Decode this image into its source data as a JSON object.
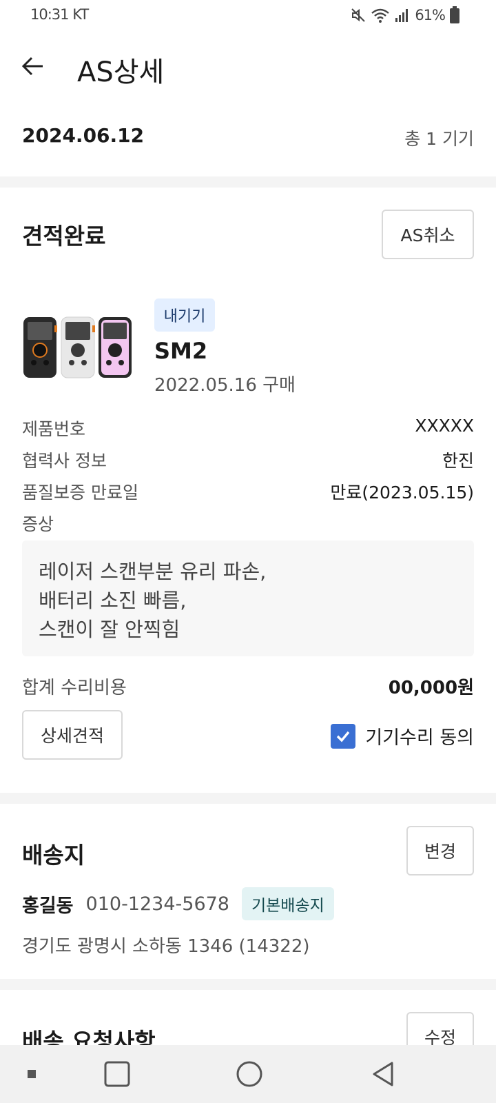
{
  "status_bar": {
    "time": "10:31 KT",
    "battery": "61%",
    "icons": [
      "mute-icon",
      "wifi-icon",
      "signal-icon",
      "battery-icon"
    ]
  },
  "app_bar": {
    "title": "AS상세",
    "back_icon": "arrow-left-icon"
  },
  "summary": {
    "date": "2024.06.12",
    "count": "총 1 기기"
  },
  "estimate": {
    "status": "견적완료",
    "cancel_label": "AS취소",
    "product": {
      "badge": "내기기",
      "model": "SM2",
      "purchase": "2022.05.16 구매",
      "colors": [
        "#3a3a3a",
        "#efefef",
        "#f3c6f0"
      ]
    },
    "details": [
      {
        "label": "제품번호",
        "value": "XXXXX"
      },
      {
        "label": "협력사 정보",
        "value": "한진"
      },
      {
        "label": "품질보증 만료일",
        "value": "만료(2023.05.15)"
      }
    ],
    "symptom_label": "증상",
    "symptom_lines": [
      "레이저 스캔부분 유리 파손,",
      "배터리 소진 빠름,",
      "스캔이 잘 안찍힘"
    ],
    "total_label": "합계 수리비용",
    "total_value": "00,000원",
    "detail_btn": "상세견적",
    "agree_label": "기기수리 동의",
    "agree_checked": true,
    "accent_color": "#3a6fd3"
  },
  "shipping": {
    "title": "배송지",
    "change_label": "변경",
    "name": "홍길동",
    "phone": "010-1234-5678",
    "default_badge": "기본배송지",
    "address": "경기도 광명시 소하동 1346 (14322)"
  },
  "request": {
    "title": "배송 요청사항",
    "edit_label": "수정"
  },
  "nav_bar": {
    "icons": [
      "recent-dot-icon",
      "recents-square-icon",
      "home-circle-icon",
      "back-triangle-icon"
    ]
  }
}
